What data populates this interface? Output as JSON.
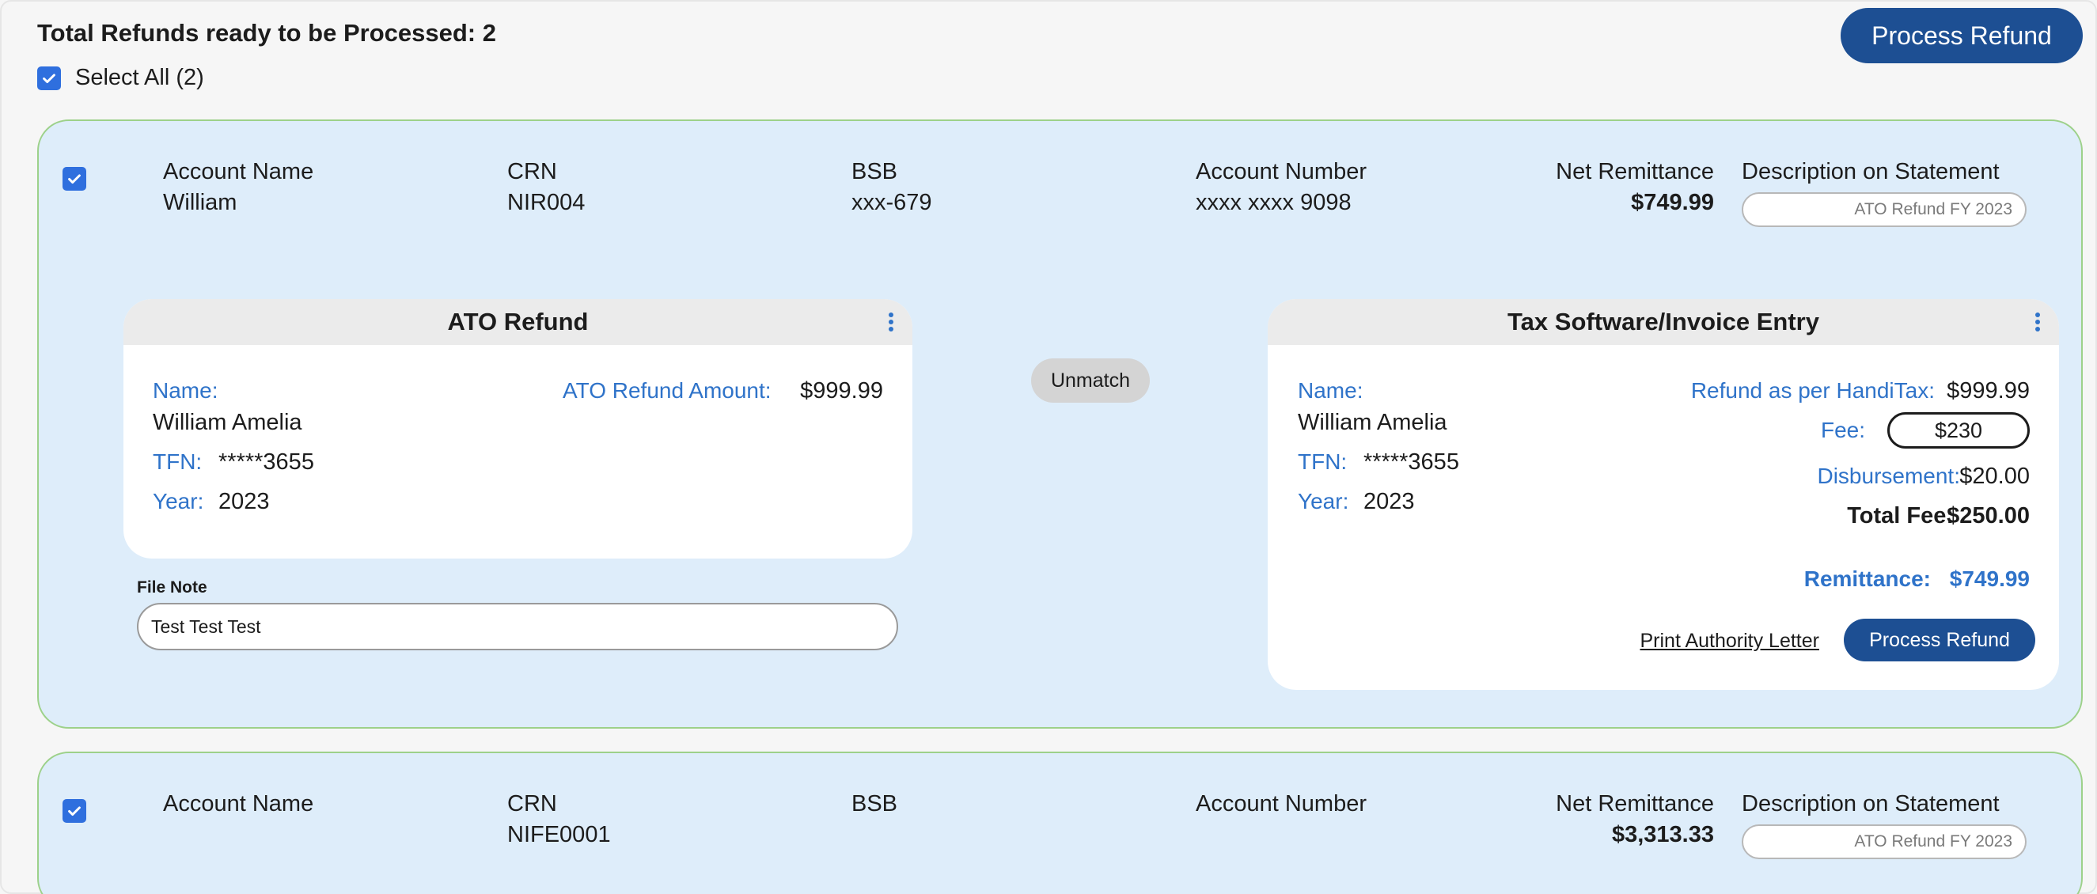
{
  "header": {
    "title": "Total Refunds ready to be Processed: 2",
    "select_all_label": "Select All (2)",
    "process_refund_label": "Process Refund"
  },
  "columns": {
    "account_name": "Account Name",
    "crn": "CRN",
    "bsb": "BSB",
    "account_number": "Account Number",
    "net_remittance": "Net Remittance",
    "description": "Description on Statement"
  },
  "cards": [
    {
      "checked": true,
      "account_name": "William",
      "crn": "NIR004",
      "bsb": "xxx-679",
      "account_number": "xxxx xxxx 9098",
      "net_remittance": "$749.99",
      "description": "ATO Refund FY 2023",
      "ato": {
        "title": "ATO Refund",
        "name_label": "Name:",
        "name": "William Amelia",
        "tfn_label": "TFN:",
        "tfn": "*****3655",
        "year_label": "Year:",
        "year": "2023",
        "amount_label": "ATO Refund Amount:",
        "amount": "$999.99"
      },
      "unmatch_label": "Unmatch",
      "file_note_label": "File Note",
      "file_note": "Test Test Test",
      "tax": {
        "title": "Tax Software/Invoice Entry",
        "name_label": "Name:",
        "name": "William Amelia",
        "tfn_label": "TFN:",
        "tfn": "*****3655",
        "year_label": "Year:",
        "year": "2023",
        "refund_label": "Refund as per HandiTax:",
        "refund": "$999.99",
        "fee_label": "Fee:",
        "fee": "$230",
        "disbursement_label": "Disbursement:",
        "disbursement": "$20.00",
        "total_fee_label": "Total Fee:",
        "total_fee": "$250.00",
        "remittance_label": "Remittance:",
        "remittance": "$749.99",
        "print_label": "Print Authority Letter",
        "process_label": "Process Refund"
      }
    },
    {
      "checked": true,
      "account_name": "",
      "crn": "NIFE0001",
      "bsb": "",
      "account_number": "",
      "net_remittance": "$3,313.33",
      "description": "ATO Refund FY 2023"
    }
  ],
  "colors": {
    "primary_button": "#1d4f93",
    "card_bg": "#deedfa",
    "card_border": "#9dd18a",
    "label_blue": "#2f73c9",
    "checkbox": "#2f6fde"
  }
}
